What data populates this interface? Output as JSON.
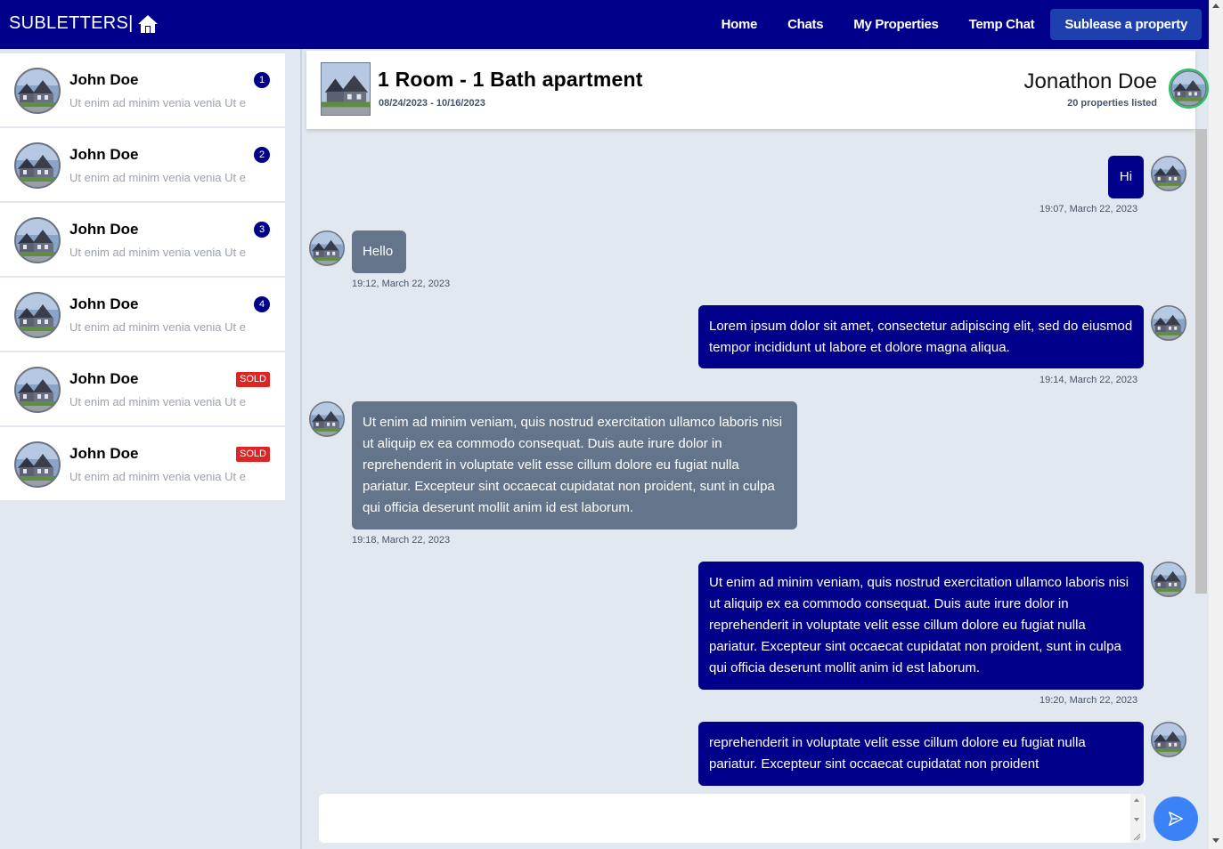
{
  "navbar": {
    "brand": "SUBLETTERS|",
    "brand_icon": "house-icon",
    "links": [
      "Home",
      "Chats",
      "My Properties",
      "Temp Chat"
    ],
    "cta": "Sublease a property",
    "color": "#00008b"
  },
  "sidebar": {
    "chats": [
      {
        "name": "John Doe",
        "preview": "Ut enim ad minim venia venia Ut e",
        "badge": "1",
        "badge_type": "count"
      },
      {
        "name": "John Doe",
        "preview": "Ut enim ad minim venia venia Ut e",
        "badge": "2",
        "badge_type": "count"
      },
      {
        "name": "John Doe",
        "preview": "Ut enim ad minim venia venia Ut e",
        "badge": "3",
        "badge_type": "count"
      },
      {
        "name": "John Doe",
        "preview": "Ut enim ad minim venia venia Ut e",
        "badge": "4",
        "badge_type": "count"
      },
      {
        "name": "John Doe",
        "preview": "Ut enim ad minim venia venia Ut e",
        "badge": "SOLD",
        "badge_type": "sold"
      },
      {
        "name": "John Doe",
        "preview": "Ut enim ad minim venia venia Ut e",
        "badge": "SOLD",
        "badge_type": "sold"
      }
    ]
  },
  "chat_header": {
    "property_title": "1 Room - 1 Bath apartment",
    "dates": "08/24/2023 - 10/16/2023",
    "host_name": "Jonathon Doe",
    "host_listed": "20 properties listed"
  },
  "messages": [
    {
      "direction": "out",
      "text": "Hi",
      "time": "19:07, March 22, 2023"
    },
    {
      "direction": "in",
      "text": "Hello",
      "time": "19:12, March 22, 2023"
    },
    {
      "direction": "out",
      "text": "Lorem ipsum dolor sit amet, consectetur adipiscing elit, sed do eiusmod tempor incididunt ut labore et dolore magna aliqua.",
      "time": "19:14, March 22, 2023"
    },
    {
      "direction": "in",
      "text": "Ut enim ad minim veniam, quis nostrud exercitation ullamco laboris nisi ut aliquip ex ea commodo consequat. Duis aute irure dolor in reprehenderit in voluptate velit esse cillum dolore eu fugiat nulla pariatur. Excepteur sint occaecat cupidatat non proident, sunt in culpa qui officia deserunt mollit anim id est laborum.",
      "time": "19:18, March 22, 2023"
    },
    {
      "direction": "out",
      "text": "Ut enim ad minim veniam, quis nostrud exercitation ullamco laboris nisi ut aliquip ex ea commodo consequat. Duis aute irure dolor in reprehenderit in voluptate velit esse cillum dolore eu fugiat nulla pariatur. Excepteur sint occaecat cupidatat non proident, sunt in culpa qui officia deserunt mollit anim id est laborum.",
      "time": "19:20, March 22, 2023"
    },
    {
      "direction": "out",
      "text": "reprehenderit in voluptate velit esse cillum dolore eu fugiat nulla pariatur. Excepteur sint occaecat cupidatat non proident",
      "time": ""
    }
  ],
  "composer": {
    "value": "",
    "send_icon": "send-icon"
  },
  "colors": {
    "outgoing_bubble": "#00008b",
    "incoming_bubble": "#64748b",
    "sold_badge": "#dc2626",
    "send_button": "#3b82f6",
    "online_ring": "#22c55e"
  }
}
